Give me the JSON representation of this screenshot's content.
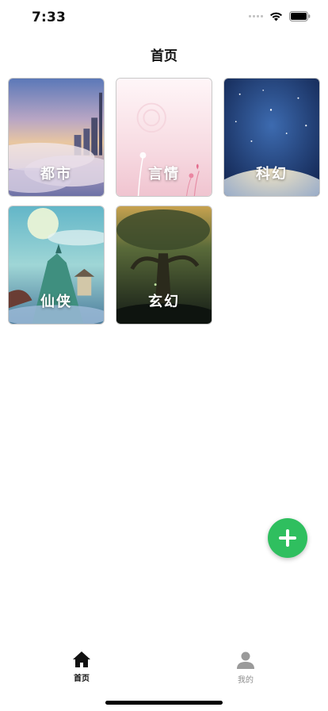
{
  "status_bar": {
    "time": "7:33"
  },
  "header": {
    "title": "首页"
  },
  "cards": [
    {
      "label": "都市",
      "theme": "city"
    },
    {
      "label": "言情",
      "theme": "romance"
    },
    {
      "label": "科幻",
      "theme": "scifi"
    },
    {
      "label": "仙侠",
      "theme": "xianxia"
    },
    {
      "label": "玄幻",
      "theme": "fantasy"
    }
  ],
  "fab": {
    "icon": "plus-icon",
    "color": "#2fbf5f"
  },
  "tab_bar": {
    "items": [
      {
        "label": "首页",
        "icon": "home-icon",
        "active": true
      },
      {
        "label": "我的",
        "icon": "person-icon",
        "active": false
      }
    ]
  },
  "colors": {
    "accent": "#2fbf5f",
    "tab_active": "#111111",
    "tab_inactive": "#8e8e8e"
  }
}
